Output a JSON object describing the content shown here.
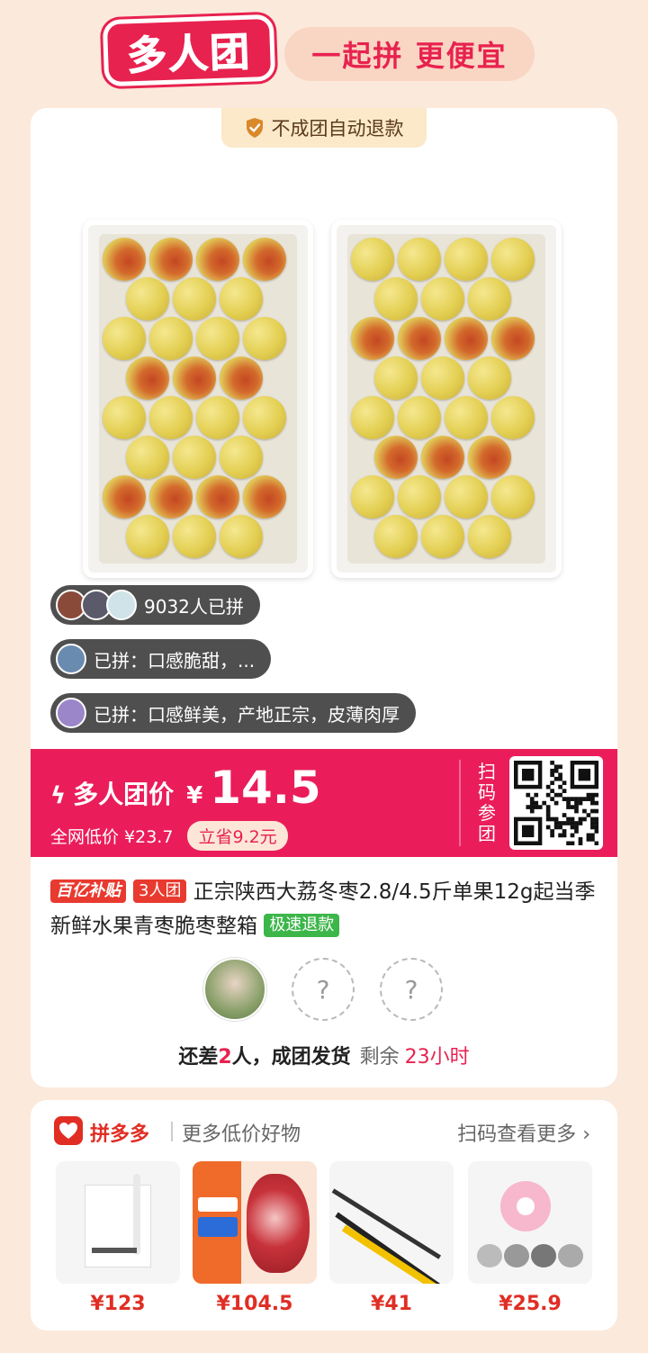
{
  "header": {
    "title": "多人团",
    "slogan": "一起拼 更便宜"
  },
  "card": {
    "refund_tag": "不成团自动退款",
    "bubbles": [
      {
        "text": "9032人已拼"
      },
      {
        "text": "已拼：口感脆甜，..."
      },
      {
        "text": "已拼：口感鲜美，产地正宗，皮薄肉厚"
      }
    ],
    "price_bar": {
      "icon": "lightning-icon",
      "label": "多人团价",
      "currency": "¥",
      "price": "14.5",
      "market_label": "全网低价 ¥23.7",
      "save_label": "立省9.2元",
      "scan_label": "扫码参团",
      "accent_color": "#ea1d5a"
    },
    "product": {
      "tag_subsidy": "百亿补贴",
      "tag_group": "3人团",
      "title": "正宗陕西大荔冬枣2.8/4.5斤单果12g起当季新鲜水果青枣脆枣整箱",
      "tag_refund": "极速退款"
    },
    "team": {
      "placeholder": "?",
      "status_prefix": "还差",
      "missing_count": "2",
      "status_suffix": "人，成团发货",
      "remaining_label": "剩余",
      "remaining_time": "23小时"
    }
  },
  "more": {
    "brand": "拼多多",
    "subtitle": "更多低价好物",
    "link": "扫码查看更多",
    "goods": [
      {
        "price": "¥123"
      },
      {
        "price": "¥104.5"
      },
      {
        "price": "¥41"
      },
      {
        "price": "¥25.9"
      }
    ]
  }
}
